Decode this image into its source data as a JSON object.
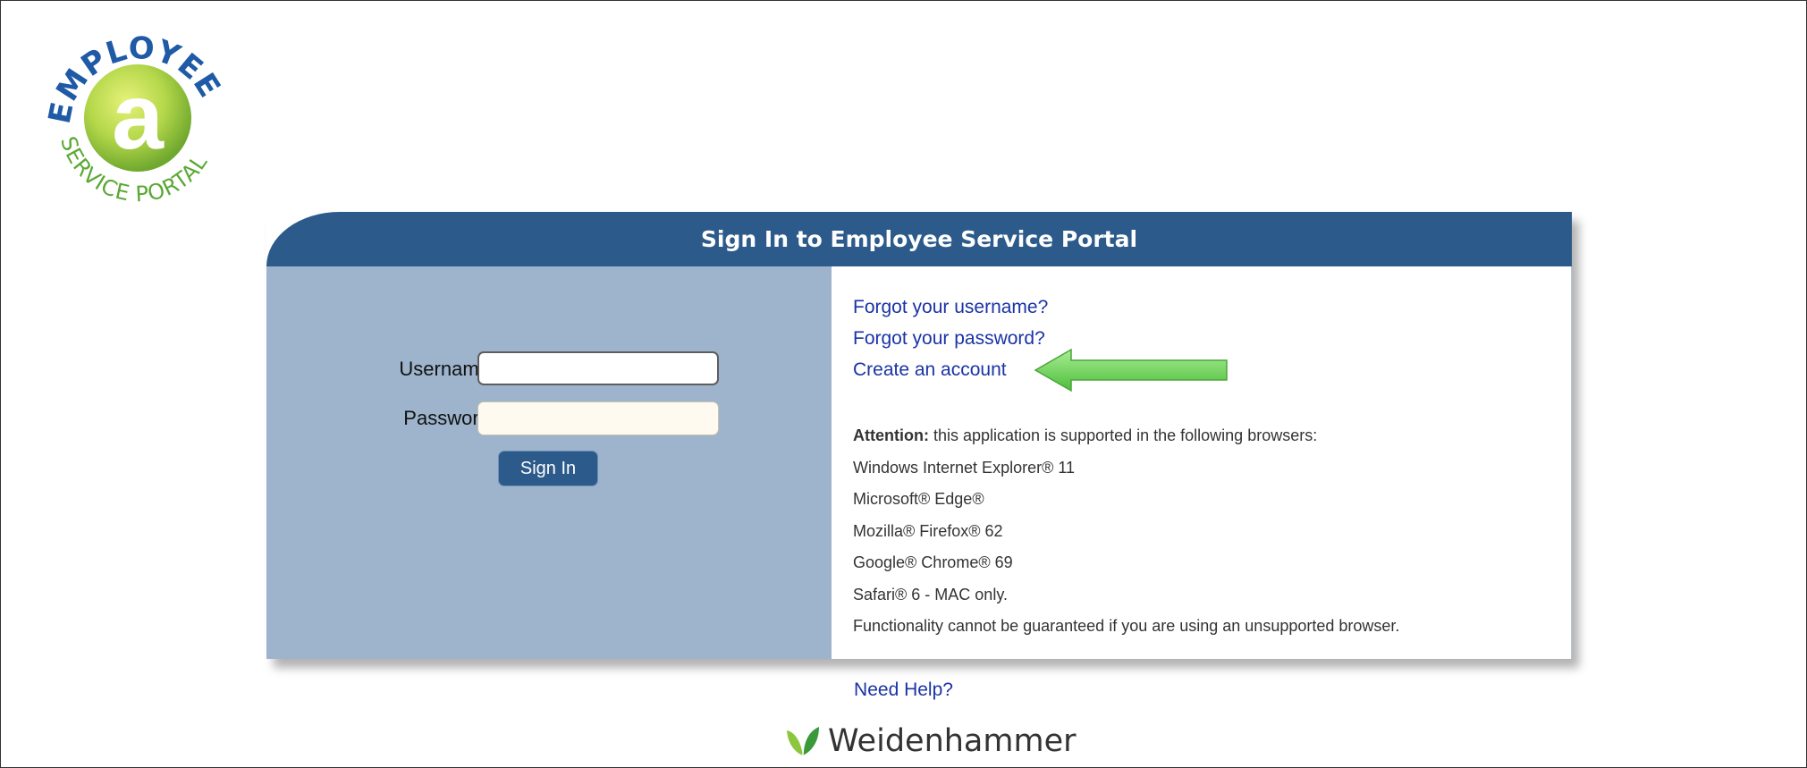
{
  "logo": {
    "ring_text_top": "EMPLOYEE",
    "ring_text_bottom": "SERVICE PORTAL",
    "center_letter": "a"
  },
  "card": {
    "title": "Sign In to Employee Service Portal",
    "form": {
      "username_label": "Username:",
      "password_label": "Password:",
      "username_value": "",
      "password_value": "",
      "signin_label": "Sign In"
    },
    "links": {
      "forgot_username": "Forgot your username?",
      "forgot_password": "Forgot your password?",
      "create_account": "Create an account"
    },
    "notice": {
      "attention_bold": "Attention:",
      "attention_text": " this application is supported in the following browsers:",
      "browsers": [
        "Windows Internet Explorer® 11",
        "Microsoft® Edge®",
        "Mozilla® Firefox® 62",
        "Google® Chrome® 69",
        "Safari® 6 - MAC only."
      ],
      "disclaimer": "Functionality cannot be guaranteed if you are using an unsupported browser."
    }
  },
  "help_link": "Need Help?",
  "brand_name": "Weidenhammer",
  "colors": {
    "header_blue": "#2c5a8a",
    "left_panel": "#9db4cc",
    "link_blue": "#1a33a6",
    "arrow_green": "#6fd35c",
    "logo_green": "#8cc63f"
  },
  "icons": {
    "arrow": "green-left-arrow-icon",
    "brand": "weidenhammer-leaf-icon"
  }
}
